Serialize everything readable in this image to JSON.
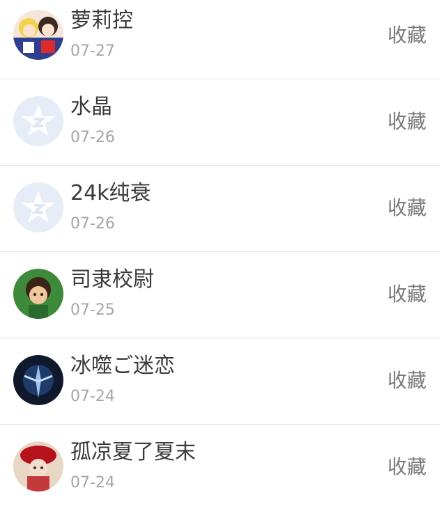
{
  "rows": [
    {
      "name": "萝莉控",
      "date": "07-27",
      "action": "收藏",
      "avatar": "anime-girls-avatar"
    },
    {
      "name": "水晶",
      "date": "07-26",
      "action": "收藏",
      "avatar": "default-qq-avatar"
    },
    {
      "name": "24k纯衰",
      "date": "07-26",
      "action": "收藏",
      "avatar": "default-qq-avatar"
    },
    {
      "name": "司隶校尉",
      "date": "07-25",
      "action": "收藏",
      "avatar": "cartoon-warrior-avatar"
    },
    {
      "name": "冰噬ご迷恋",
      "date": "07-24",
      "action": "收藏",
      "avatar": "dark-warrior-avatar"
    },
    {
      "name": "孤凉夏了夏末",
      "date": "07-24",
      "action": "收藏",
      "avatar": "red-hat-girl-avatar"
    }
  ],
  "colors": {
    "name_text": "#3a3a3a",
    "date_text": "#a6a6a6",
    "action_text": "#7a7a7a",
    "divider": "#e3e3e3",
    "default_avatar_bg": "#e6edf7"
  }
}
